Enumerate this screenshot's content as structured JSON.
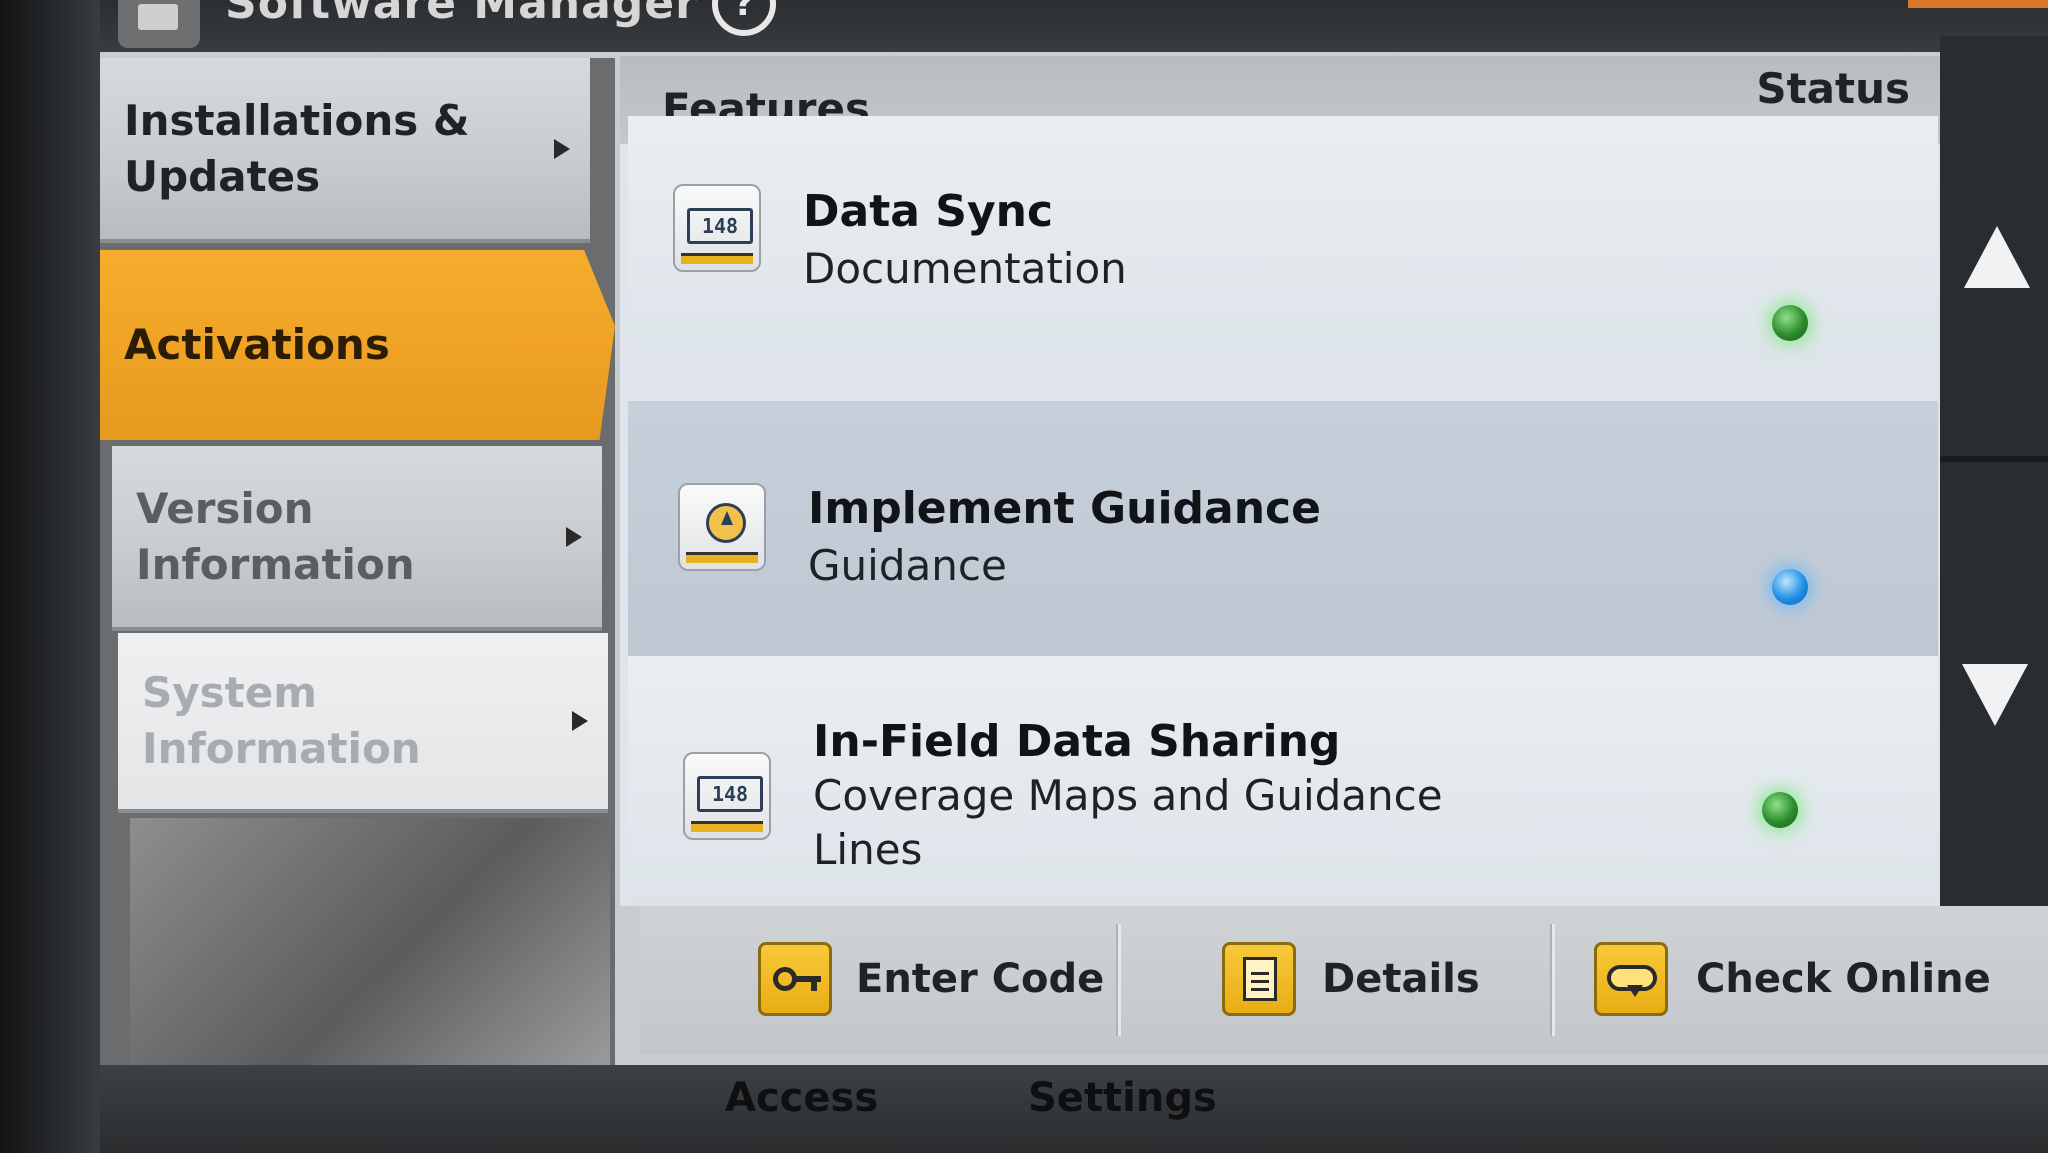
{
  "app": {
    "title": "Software Manager",
    "help_symbol": "?"
  },
  "menu": {
    "items": [
      {
        "label": "Installations & Updates",
        "selected": false,
        "enabled": true
      },
      {
        "label": "Activations",
        "selected": true,
        "enabled": true
      },
      {
        "label": "Version Information",
        "selected": false,
        "enabled": true
      },
      {
        "label": "System Information",
        "selected": false,
        "enabled": false
      }
    ]
  },
  "list": {
    "header_features": "Features",
    "header_status": "Status",
    "rows": [
      {
        "title": "Data Sync",
        "subtitle": "Documentation",
        "icon": "counter-icon",
        "counter": "148",
        "status_color": "#3fbf3f"
      },
      {
        "title": "Implement Guidance",
        "subtitle": "Guidance",
        "icon": "compass-icon",
        "status_color": "#1f8fe6"
      },
      {
        "title": "In-Field Data Sharing",
        "subtitle": "Coverage Maps and Guidance Lines",
        "icon": "counter-icon",
        "counter": "148",
        "status_color": "#3fbf3f"
      }
    ]
  },
  "toolbar": {
    "enter_code": "Enter Code",
    "details": "Details",
    "check_online": "Check Online"
  },
  "bottom_tabs": {
    "access": "Access",
    "settings": "Settings"
  },
  "colors": {
    "accent_orange": "#f0a324",
    "status_green": "#3fbf3f",
    "status_blue": "#1f8fe6",
    "button_yellow": "#f2bb26"
  }
}
